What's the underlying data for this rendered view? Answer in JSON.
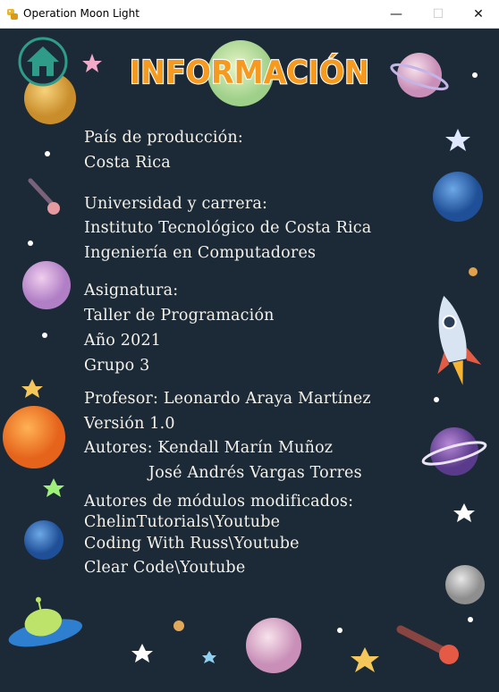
{
  "window": {
    "title": "Operation Moon Light",
    "minimize_glyph": "—",
    "maximize_glyph": "☐",
    "close_glyph": "✕"
  },
  "heading": "INFORMACIÓN",
  "home_icon": "home-icon",
  "colors": {
    "background": "#1c2a37",
    "heading_fill": "#f59a1e",
    "heading_outline": "#ffffff",
    "home_teal": "#2f9c8a",
    "text": "#f5f2ea"
  },
  "info": {
    "pais_label": "País de producción:",
    "pais_value": "Costa Rica",
    "universidad_label": "Universidad y carrera:",
    "universidad_value": "Instituto Tecnológico de Costa Rica",
    "carrera_value": "Ingeniería en Computadores",
    "asignatura_label": "Asignatura:",
    "asignatura_value": "Taller de Programación",
    "anio": "Año 2021",
    "grupo": "Grupo 3",
    "profesor": "Profesor: Leonardo Araya Martínez",
    "version": "Versión 1.0",
    "autores": "Autores: Kendall Marín Muñoz",
    "autor2": "José Andrés Vargas Torres",
    "modulos_label": "Autores de módulos modificados:",
    "modulo1": "ChelinTutorials\\Youtube",
    "modulo2": "Coding With Russ\\Youtube",
    "modulo3": "Clear Code\\Youtube"
  }
}
